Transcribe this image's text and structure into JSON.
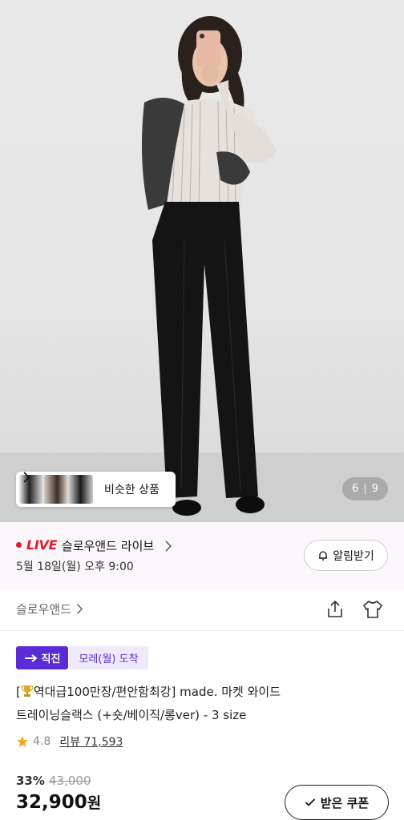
{
  "gallery": {
    "similar_label": "비슷한 상품",
    "current": "6",
    "separator": "|",
    "total": "9"
  },
  "live": {
    "tag": "LIVE",
    "store": "슬로우앤드 라이브",
    "time": "5월 18일(월) 오후 9:00",
    "alarm_label": "알림받기"
  },
  "store": {
    "name": "슬로우앤드"
  },
  "badges": {
    "direct": "직진",
    "arrival": "모레(월) 도착"
  },
  "product": {
    "title_line1": "역대급100만장/편안함최강] made. 마켓 와이드",
    "title_prefix": "[",
    "title_line2": "트레이닝슬랙스 (+숏/베이직/롱ver) - 3 size",
    "rating": "4.8",
    "reviews": "리뷰 71,593",
    "discount": "33%",
    "original_price": "43,000",
    "price": "32,900",
    "currency": "원",
    "coupon_label": "받은 쿠폰"
  },
  "colors": {
    "brand_purple": "#5b2cd6",
    "live_red": "#e5192b",
    "star": "#f5a623"
  }
}
